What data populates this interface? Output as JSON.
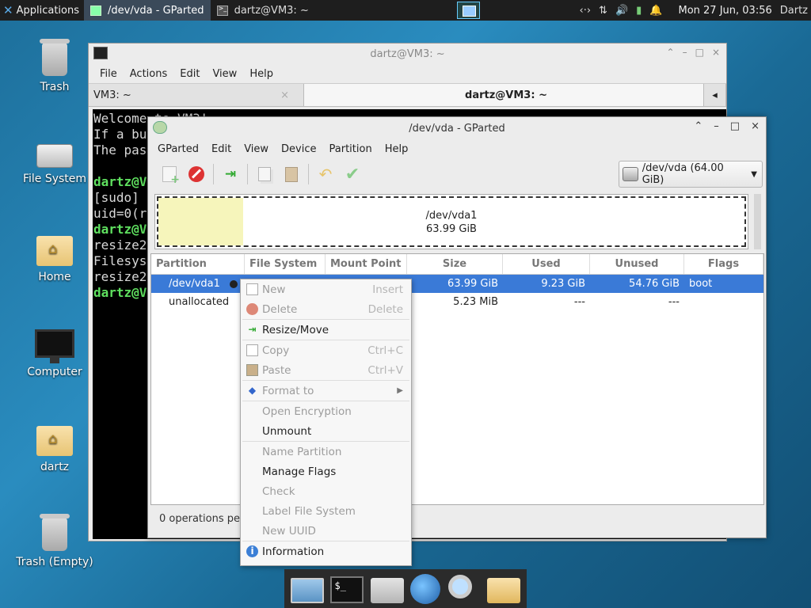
{
  "top_panel": {
    "applications_label": "Applications",
    "tasks": [
      {
        "label": "/dev/vda - GParted",
        "active": true
      },
      {
        "label": "dartz@VM3: ~",
        "active": false
      }
    ],
    "tray": {
      "network": "‹·›",
      "arrows": "⇅",
      "volume": "🔊",
      "battery": "▮",
      "bell": "🔔"
    },
    "clock": "Mon 27 Jun, 03:56",
    "user": "Dartz"
  },
  "desktop_icons": [
    {
      "label": "Trash",
      "icon": "trash-icon"
    },
    {
      "label": "File System",
      "icon": "drive-icon"
    },
    {
      "label": "Home",
      "icon": "home-folder-icon"
    },
    {
      "label": "Computer",
      "icon": "monitor-icon"
    },
    {
      "label": "dartz",
      "icon": "home-folder-icon"
    },
    {
      "label": "Trash (Empty)",
      "icon": "trash-icon"
    }
  ],
  "terminal": {
    "title": "dartz@VM3: ~",
    "menu": [
      "File",
      "Actions",
      "Edit",
      "View",
      "Help"
    ],
    "tabs": [
      {
        "label": "VM3: ~",
        "close": "×"
      },
      {
        "label": "dartz@VM3: ~"
      }
    ],
    "scroll_arrow": "◂",
    "lines": [
      {
        "text": "Welcome to VM3!",
        "prompt": false
      },
      {
        "text": "If a bu",
        "prompt": false
      },
      {
        "text": "The pas",
        "prompt": false
      },
      {
        "text": "",
        "prompt": false
      },
      {
        "text": "dartz@V",
        "prompt": true
      },
      {
        "text": "[sudo] ",
        "prompt": false
      },
      {
        "text": "uid=0(r",
        "prompt": false
      },
      {
        "text": "dartz@V",
        "prompt": true
      },
      {
        "text": "resize2",
        "prompt": false
      },
      {
        "text": "Filesys",
        "prompt": false
      },
      {
        "text": "resize2",
        "prompt": false
      },
      {
        "text": "dartz@V",
        "prompt": true
      }
    ]
  },
  "gparted": {
    "title": "/dev/vda - GParted",
    "window_controls": {
      "up": "⌃",
      "min": "–",
      "max": "□",
      "close": "×"
    },
    "menu": [
      "GParted",
      "Edit",
      "View",
      "Device",
      "Partition",
      "Help"
    ],
    "device_selector": "/dev/vda (64.00 GiB)",
    "disk_map": {
      "name": "/dev/vda1",
      "size": "63.99 GiB",
      "used_fraction": 0.144
    },
    "columns": [
      "Partition",
      "File System",
      "Mount Point",
      "Size",
      "Used",
      "Unused",
      "Flags"
    ],
    "rows": [
      {
        "partition": "/dev/vda1",
        "filesystem": "",
        "mount": "",
        "size": "63.99 GiB",
        "used": "9.23 GiB",
        "unused": "54.76 GiB",
        "flags": "boot",
        "selected": true
      },
      {
        "partition": "unallocated",
        "filesystem": "",
        "mount": "",
        "size": "5.23 MiB",
        "used": "---",
        "unused": "---",
        "flags": "",
        "selected": false
      }
    ],
    "status": "0 operations pe"
  },
  "context_menu": [
    {
      "label": "New",
      "accel": "Insert",
      "enabled": false,
      "icon": "new-partition-icon"
    },
    {
      "label": "Delete",
      "accel": "Delete",
      "enabled": false,
      "icon": "delete-icon"
    },
    {
      "sep": true
    },
    {
      "label": "Resize/Move",
      "accel": "",
      "enabled": true,
      "icon": "resize-icon"
    },
    {
      "sep": true
    },
    {
      "label": "Copy",
      "accel": "Ctrl+C",
      "enabled": false,
      "icon": "copy-icon"
    },
    {
      "label": "Paste",
      "accel": "Ctrl+V",
      "enabled": false,
      "icon": "paste-icon"
    },
    {
      "sep": true
    },
    {
      "label": "Format to",
      "accel": "",
      "enabled": false,
      "icon": "format-icon",
      "submenu": true
    },
    {
      "sep": true
    },
    {
      "label": "Open Encryption",
      "accel": "",
      "enabled": false,
      "icon": ""
    },
    {
      "label": "Unmount",
      "accel": "",
      "enabled": true,
      "icon": ""
    },
    {
      "sep": true
    },
    {
      "label": "Name Partition",
      "accel": "",
      "enabled": false,
      "icon": ""
    },
    {
      "label": "Manage Flags",
      "accel": "",
      "enabled": true,
      "icon": ""
    },
    {
      "label": "Check",
      "accel": "",
      "enabled": false,
      "icon": ""
    },
    {
      "label": "Label File System",
      "accel": "",
      "enabled": false,
      "icon": ""
    },
    {
      "label": "New UUID",
      "accel": "",
      "enabled": false,
      "icon": ""
    },
    {
      "sep": true
    },
    {
      "label": "Information",
      "accel": "",
      "enabled": true,
      "icon": "info-icon"
    }
  ],
  "dock": [
    {
      "icon": "show-desktop-icon"
    },
    {
      "icon": "terminal-icon"
    },
    {
      "icon": "home-icon"
    },
    {
      "icon": "web-browser-icon"
    },
    {
      "icon": "search-icon"
    },
    {
      "icon": "folder-icon"
    }
  ],
  "colors": {
    "selection": "#3a7ad7",
    "used_space": "#f6f5bb",
    "prompt": "#5fe05f"
  }
}
